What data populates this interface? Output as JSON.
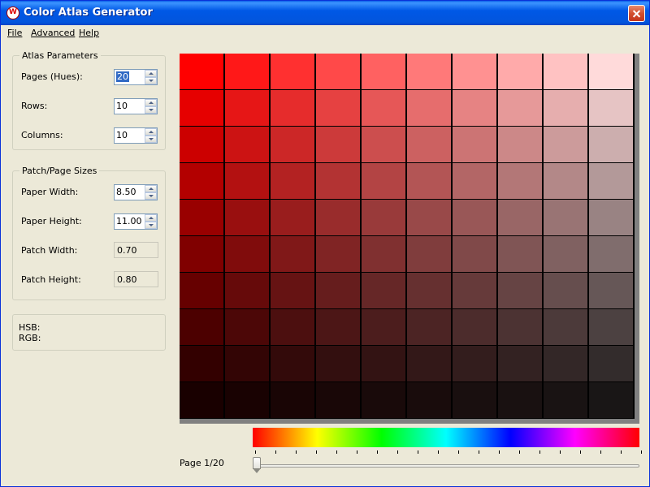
{
  "window": {
    "title": "Color Atlas Generator"
  },
  "menu": {
    "file": "File",
    "advanced": "Advanced",
    "help": "Help"
  },
  "atlas_parameters": {
    "legend": "Atlas Parameters",
    "pages_label": "Pages (Hues):",
    "pages_value": "20",
    "rows_label": "Rows:",
    "rows_value": "10",
    "columns_label": "Columns:",
    "columns_value": "10"
  },
  "sizes": {
    "legend": "Patch/Page Sizes",
    "paper_width_label": "Paper Width:",
    "paper_width_value": "8.50",
    "paper_height_label": "Paper Height:",
    "paper_height_value": "11.00",
    "patch_width_label": "Patch Width:",
    "patch_width_value": "0.70",
    "patch_height_label": "Patch Height:",
    "patch_height_value": "0.80"
  },
  "info": {
    "hsb": "HSB:",
    "rgb": "RGB:"
  },
  "atlas": {
    "hue": 0,
    "rows": 10,
    "columns": 10
  },
  "slider": {
    "page_label": "Page 1/20",
    "page": 1,
    "total": 20
  }
}
